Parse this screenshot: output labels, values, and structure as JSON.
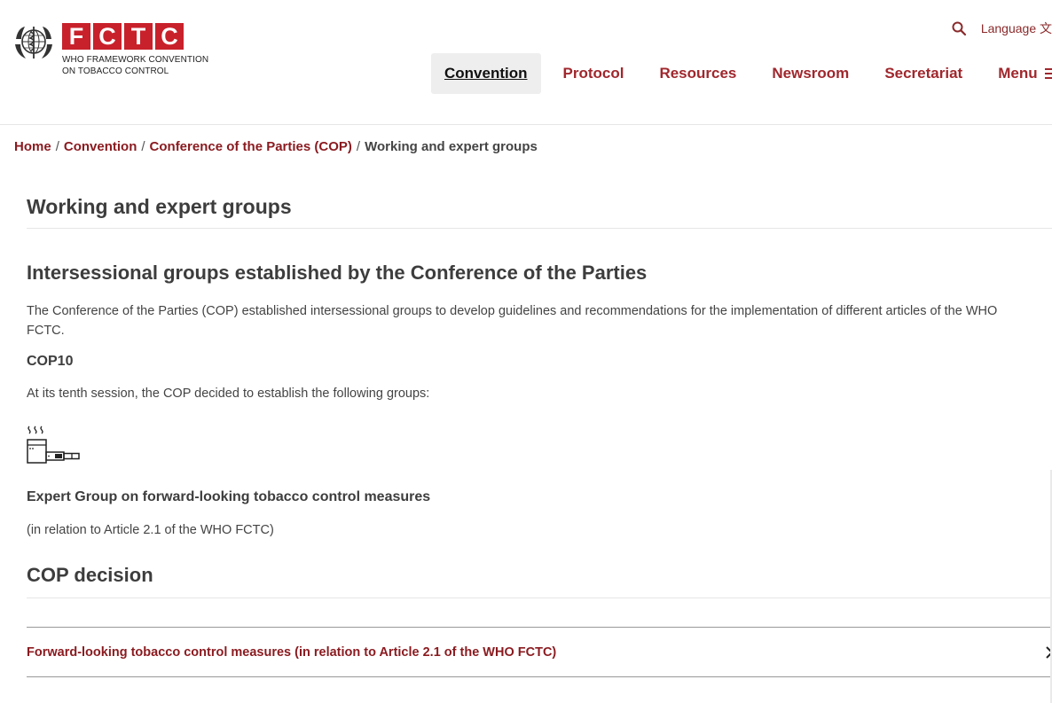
{
  "header": {
    "logo": {
      "letters": [
        "F",
        "C",
        "T",
        "C"
      ],
      "subtitle_line1": "WHO FRAMEWORK CONVENTION",
      "subtitle_line2": "ON TOBACCO CONTROL",
      "icon": "who-emblem-icon"
    },
    "utility": {
      "search_icon": "search-icon",
      "language_label": "Language 文"
    },
    "nav": {
      "items": [
        {
          "label": "Convention",
          "active": true
        },
        {
          "label": "Protocol"
        },
        {
          "label": "Resources"
        },
        {
          "label": "Newsroom"
        },
        {
          "label": "Secretariat"
        }
      ],
      "menu_label": "Menu",
      "menu_icon": "hamburger-icon"
    }
  },
  "breadcrumb": {
    "items": [
      "Home",
      "Convention",
      "Conference of the Parties (COP)"
    ],
    "separator": "/",
    "current": "Working and expert groups"
  },
  "main": {
    "page_title": "Working and expert groups",
    "section_title": "Intersessional groups established by the Conference of the Parties",
    "intro": "The Conference of the Parties (COP) established intersessional groups to develop guidelines and recommendations for the implementation of different articles of the WHO FCTC.",
    "cop10_heading": "COP10",
    "cop10_intro": "At its tenth session, the COP decided to establish the following groups:",
    "group": {
      "icon": "tobacco-products-icon",
      "title": "Expert Group on forward-looking tobacco control measures",
      "subtitle": "(in relation to Article 2.1 of the WHO FCTC)"
    },
    "decision_heading": "COP decision",
    "decision_link": "Forward-looking tobacco control measures (in relation to Article 2.1 of the WHO FCTC)"
  },
  "colors": {
    "brand_red": "#c8212b",
    "link_red": "#8a1a1f",
    "nav_red": "#a0272d"
  }
}
